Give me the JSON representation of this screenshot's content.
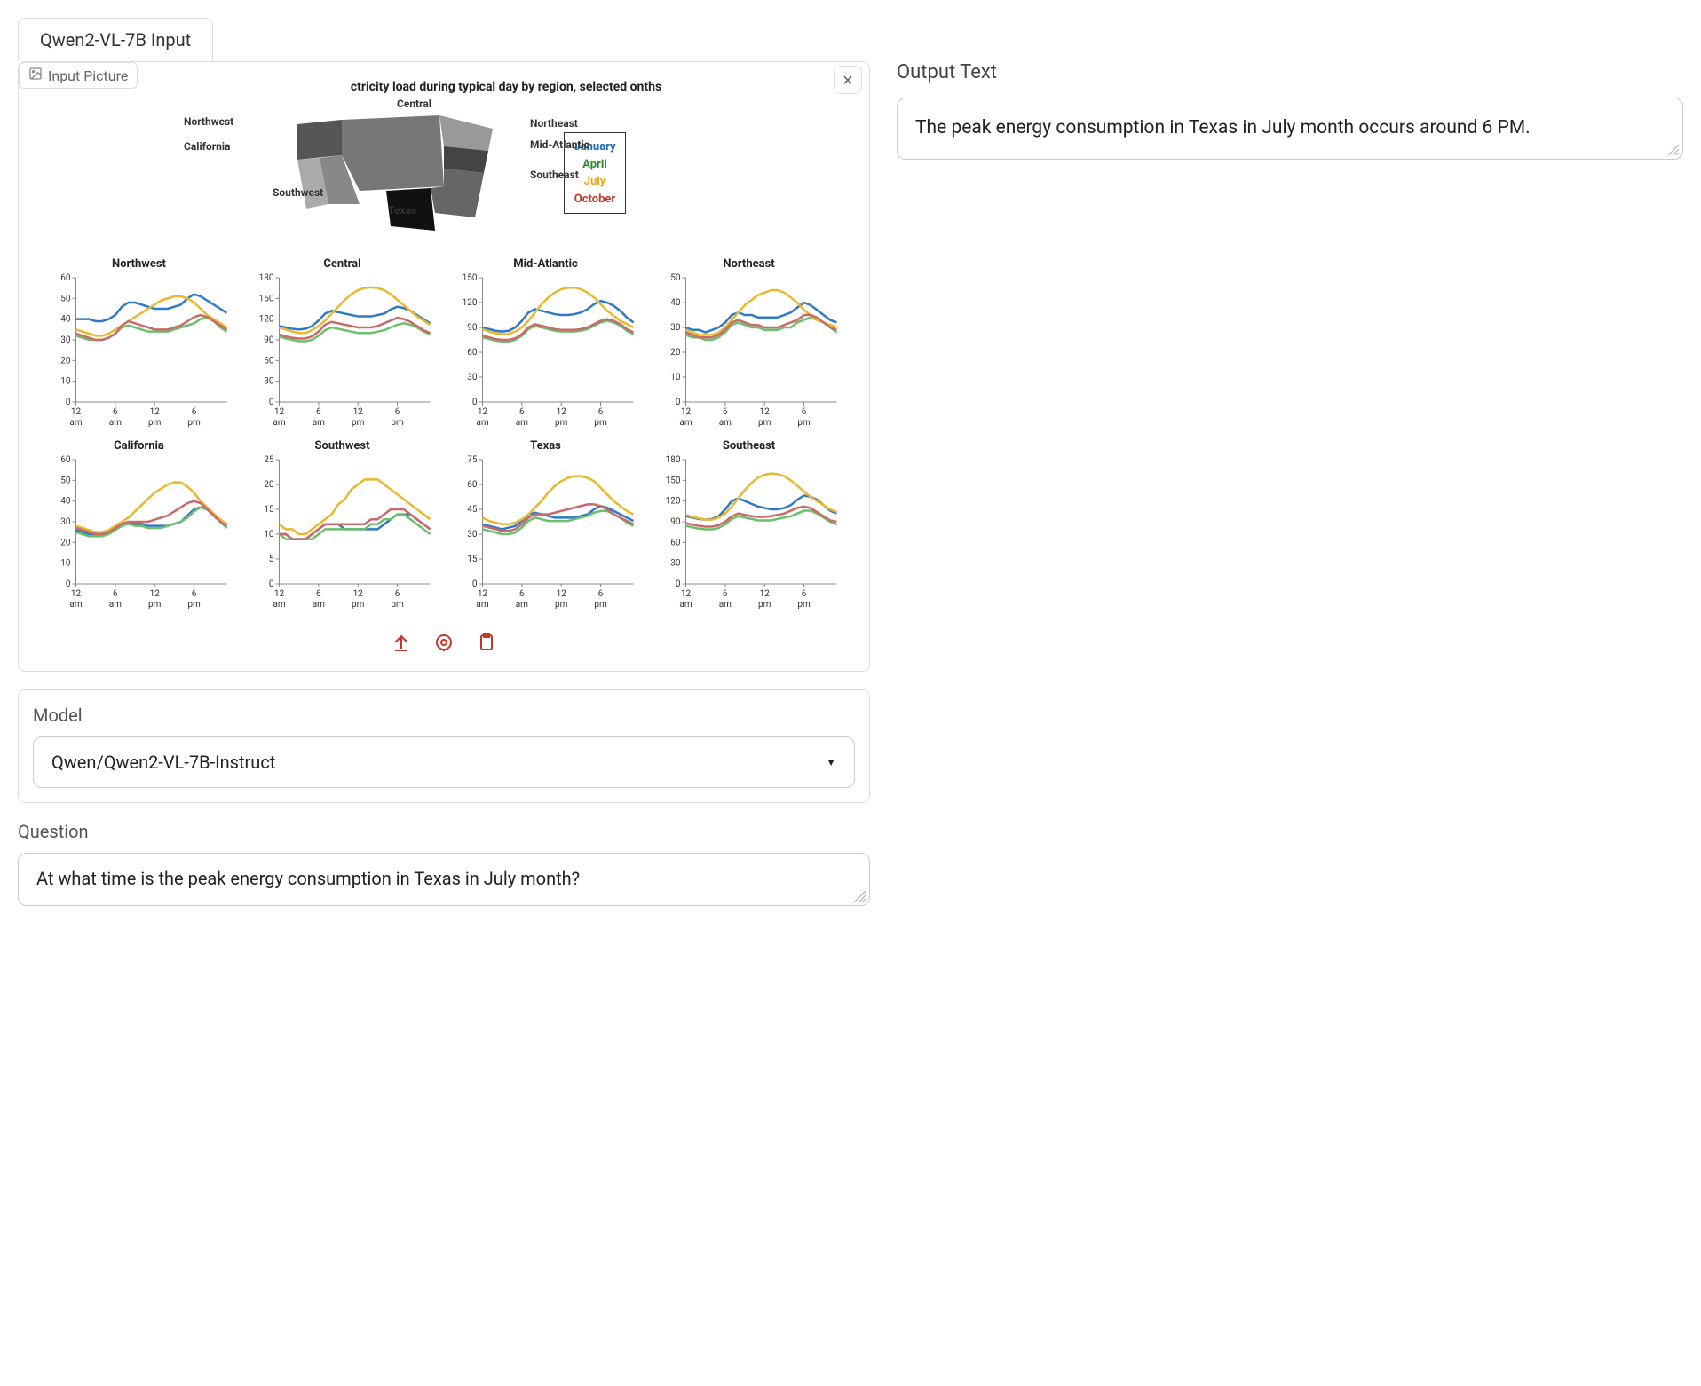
{
  "tab_label": "Qwen2-VL-7B Input",
  "input_picture_label": "Input Picture",
  "chart_header_fragment": "ctricity load during typical day by region, selected onths",
  "map_labels": {
    "northwest": "Northwest",
    "california": "California",
    "southwest": "Southwest",
    "central": "Central",
    "texas": "Texas",
    "northeast": "Northeast",
    "midatlantic": "Mid-Atlantic",
    "southeast": "Southeast"
  },
  "legend": {
    "january": "January",
    "april": "April",
    "july": "July",
    "october": "October"
  },
  "model_section_label": "Model",
  "model_value": "Qwen/Qwen2-VL-7B-Instruct",
  "question_section_label": "Question",
  "question_value": "At what time is the peak energy consumption in Texas in July month?",
  "output_section_label": "Output Text",
  "output_value": "The peak energy consumption in Texas in July month occurs around 6 PM.",
  "close_glyph": "✕",
  "chevron_glyph": "▼",
  "chart_data": {
    "type": "line",
    "title": "U.S. electricity load during typical day by region, selected months",
    "xlabel": "",
    "ylabel": "",
    "x_categories": [
      "12 am",
      "6 am",
      "12 pm",
      "6 pm"
    ],
    "x_hours": [
      0,
      1,
      2,
      3,
      4,
      5,
      6,
      7,
      8,
      9,
      10,
      11,
      12,
      13,
      14,
      15,
      16,
      17,
      18,
      19,
      20,
      21,
      22,
      23
    ],
    "legend": [
      "January",
      "April",
      "July",
      "October"
    ],
    "colors": {
      "January": "#2e7bc4",
      "April": "#6cbf6c",
      "July": "#e8b82e",
      "October": "#c86a6a"
    },
    "panels": [
      {
        "name": "Northwest",
        "ylim": [
          0,
          60
        ],
        "yticks": [
          0,
          10,
          20,
          30,
          40,
          50,
          60
        ],
        "series": {
          "January": [
            40,
            40,
            40,
            39,
            39,
            40,
            42,
            46,
            48,
            48,
            47,
            46,
            45,
            45,
            45,
            46,
            47,
            50,
            52,
            51,
            49,
            47,
            45,
            43
          ],
          "April": [
            32,
            31,
            30,
            30,
            30,
            31,
            33,
            36,
            37,
            36,
            35,
            34,
            34,
            34,
            34,
            35,
            36,
            37,
            38,
            40,
            41,
            39,
            36,
            34
          ],
          "July": [
            35,
            34,
            33,
            32,
            32,
            33,
            35,
            37,
            39,
            41,
            43,
            45,
            47,
            49,
            50,
            51,
            51,
            50,
            48,
            45,
            42,
            40,
            38,
            36
          ],
          "October": [
            33,
            32,
            31,
            30,
            30,
            31,
            33,
            37,
            39,
            38,
            37,
            36,
            35,
            35,
            35,
            36,
            37,
            39,
            41,
            42,
            41,
            39,
            37,
            35
          ]
        }
      },
      {
        "name": "Central",
        "ylim": [
          0,
          180
        ],
        "yticks": [
          0,
          30,
          60,
          90,
          120,
          150,
          180
        ],
        "series": {
          "January": [
            110,
            108,
            106,
            105,
            106,
            110,
            118,
            128,
            132,
            130,
            128,
            126,
            124,
            124,
            124,
            126,
            128,
            134,
            138,
            136,
            132,
            126,
            120,
            114
          ],
          "April": [
            95,
            92,
            90,
            88,
            88,
            90,
            96,
            104,
            108,
            106,
            104,
            102,
            100,
            100,
            100,
            102,
            104,
            108,
            112,
            114,
            112,
            108,
            102,
            98
          ],
          "July": [
            108,
            105,
            102,
            100,
            100,
            104,
            110,
            118,
            128,
            138,
            148,
            156,
            162,
            165,
            166,
            165,
            162,
            156,
            148,
            140,
            132,
            124,
            118,
            112
          ],
          "October": [
            98,
            95,
            93,
            92,
            92,
            95,
            102,
            112,
            116,
            114,
            112,
            110,
            108,
            108,
            108,
            110,
            114,
            118,
            122,
            120,
            116,
            110,
            104,
            100
          ]
        }
      },
      {
        "name": "Mid-Atlantic",
        "ylim": [
          0,
          150
        ],
        "yticks": [
          0,
          30,
          60,
          90,
          120,
          150
        ],
        "series": {
          "January": [
            90,
            88,
            86,
            85,
            86,
            90,
            98,
            108,
            112,
            110,
            108,
            106,
            105,
            105,
            106,
            108,
            112,
            118,
            122,
            120,
            116,
            110,
            102,
            96
          ],
          "April": [
            78,
            76,
            74,
            73,
            73,
            75,
            80,
            88,
            92,
            90,
            88,
            86,
            85,
            85,
            85,
            86,
            88,
            92,
            96,
            98,
            96,
            92,
            86,
            82
          ],
          "July": [
            88,
            85,
            83,
            82,
            82,
            85,
            90,
            98,
            108,
            118,
            126,
            132,
            136,
            138,
            138,
            136,
            132,
            126,
            118,
            110,
            104,
            98,
            94,
            90
          ],
          "October": [
            80,
            78,
            76,
            75,
            75,
            77,
            82,
            90,
            94,
            92,
            90,
            88,
            87,
            87,
            87,
            88,
            90,
            94,
            98,
            100,
            98,
            94,
            88,
            84
          ]
        }
      },
      {
        "name": "Northeast",
        "ylim": [
          0,
          50
        ],
        "yticks": [
          0,
          10,
          20,
          30,
          40,
          50
        ],
        "series": {
          "January": [
            30,
            29,
            29,
            28,
            29,
            30,
            32,
            35,
            36,
            35,
            35,
            34,
            34,
            34,
            34,
            35,
            36,
            38,
            40,
            39,
            37,
            35,
            33,
            32
          ],
          "April": [
            27,
            26,
            26,
            25,
            25,
            26,
            28,
            31,
            32,
            31,
            30,
            30,
            29,
            29,
            29,
            30,
            30,
            32,
            33,
            34,
            33,
            32,
            30,
            28
          ],
          "July": [
            29,
            28,
            27,
            27,
            27,
            28,
            30,
            33,
            36,
            39,
            41,
            43,
            44,
            45,
            45,
            44,
            42,
            40,
            37,
            35,
            33,
            32,
            31,
            30
          ],
          "October": [
            28,
            27,
            26,
            26,
            26,
            27,
            29,
            32,
            33,
            32,
            31,
            31,
            30,
            30,
            30,
            31,
            32,
            33,
            35,
            35,
            34,
            32,
            30,
            29
          ]
        }
      },
      {
        "name": "California",
        "ylim": [
          0,
          60
        ],
        "yticks": [
          0,
          10,
          20,
          30,
          40,
          50,
          60
        ],
        "series": {
          "January": [
            26,
            25,
            24,
            24,
            24,
            25,
            27,
            29,
            30,
            29,
            29,
            28,
            28,
            28,
            28,
            29,
            30,
            33,
            36,
            37,
            36,
            33,
            30,
            28
          ],
          "April": [
            25,
            24,
            23,
            23,
            23,
            24,
            26,
            28,
            29,
            28,
            28,
            27,
            27,
            27,
            28,
            29,
            30,
            32,
            35,
            37,
            36,
            33,
            30,
            27
          ],
          "July": [
            28,
            27,
            26,
            25,
            25,
            26,
            28,
            30,
            32,
            35,
            38,
            41,
            44,
            46,
            48,
            49,
            49,
            47,
            44,
            40,
            37,
            34,
            31,
            29
          ],
          "October": [
            27,
            26,
            25,
            24,
            24,
            25,
            27,
            29,
            30,
            30,
            30,
            30,
            31,
            32,
            33,
            35,
            37,
            39,
            40,
            39,
            36,
            33,
            30,
            28
          ]
        }
      },
      {
        "name": "Southwest",
        "ylim": [
          0,
          25
        ],
        "yticks": [
          0,
          5,
          10,
          15,
          20,
          25
        ],
        "series": {
          "January": [
            10,
            10,
            9,
            9,
            9,
            10,
            11,
            12,
            12,
            12,
            11,
            11,
            11,
            11,
            11,
            11,
            12,
            13,
            14,
            14,
            14,
            13,
            12,
            11
          ],
          "April": [
            10,
            9,
            9,
            9,
            9,
            9,
            10,
            11,
            11,
            11,
            11,
            11,
            11,
            11,
            12,
            12,
            13,
            13,
            14,
            14,
            13,
            12,
            11,
            10
          ],
          "July": [
            12,
            11,
            11,
            10,
            10,
            11,
            12,
            13,
            14,
            16,
            17,
            19,
            20,
            21,
            21,
            21,
            20,
            19,
            18,
            17,
            16,
            15,
            14,
            13
          ],
          "October": [
            10,
            10,
            9,
            9,
            9,
            10,
            11,
            12,
            12,
            12,
            12,
            12,
            12,
            12,
            13,
            13,
            14,
            15,
            15,
            15,
            14,
            13,
            12,
            11
          ]
        }
      },
      {
        "name": "Texas",
        "ylim": [
          0,
          75
        ],
        "yticks": [
          0,
          15,
          30,
          45,
          60,
          75
        ],
        "series": {
          "January": [
            36,
            35,
            34,
            33,
            34,
            35,
            38,
            42,
            43,
            42,
            41,
            40,
            40,
            40,
            40,
            41,
            42,
            45,
            47,
            46,
            44,
            42,
            40,
            38
          ],
          "April": [
            33,
            32,
            31,
            30,
            30,
            31,
            34,
            38,
            40,
            39,
            38,
            38,
            38,
            38,
            39,
            40,
            41,
            43,
            44,
            44,
            42,
            40,
            37,
            35
          ],
          "July": [
            40,
            38,
            37,
            36,
            36,
            37,
            39,
            42,
            46,
            50,
            55,
            59,
            62,
            64,
            65,
            65,
            64,
            62,
            58,
            54,
            50,
            47,
            44,
            42
          ],
          "October": [
            35,
            34,
            33,
            32,
            32,
            33,
            36,
            40,
            42,
            42,
            42,
            43,
            44,
            45,
            46,
            47,
            48,
            48,
            47,
            45,
            42,
            40,
            38,
            36
          ]
        }
      },
      {
        "name": "Southeast",
        "ylim": [
          0,
          180
        ],
        "yticks": [
          0,
          30,
          60,
          90,
          120,
          150,
          180
        ],
        "series": {
          "January": [
            98,
            96,
            94,
            93,
            94,
            98,
            108,
            120,
            124,
            120,
            116,
            112,
            110,
            108,
            108,
            110,
            114,
            122,
            128,
            126,
            122,
            114,
            106,
            102
          ],
          "April": [
            84,
            82,
            80,
            79,
            79,
            81,
            86,
            94,
            98,
            96,
            94,
            92,
            92,
            92,
            94,
            96,
            98,
            102,
            106,
            106,
            102,
            96,
            90,
            86
          ],
          "July": [
            100,
            97,
            95,
            93,
            93,
            96,
            102,
            112,
            124,
            136,
            146,
            154,
            158,
            160,
            159,
            156,
            150,
            142,
            134,
            126,
            120,
            114,
            108,
            104
          ],
          "October": [
            88,
            86,
            84,
            83,
            83,
            85,
            90,
            98,
            102,
            100,
            98,
            97,
            97,
            98,
            100,
            102,
            106,
            110,
            112,
            110,
            104,
            98,
            92,
            90
          ]
        }
      }
    ]
  }
}
